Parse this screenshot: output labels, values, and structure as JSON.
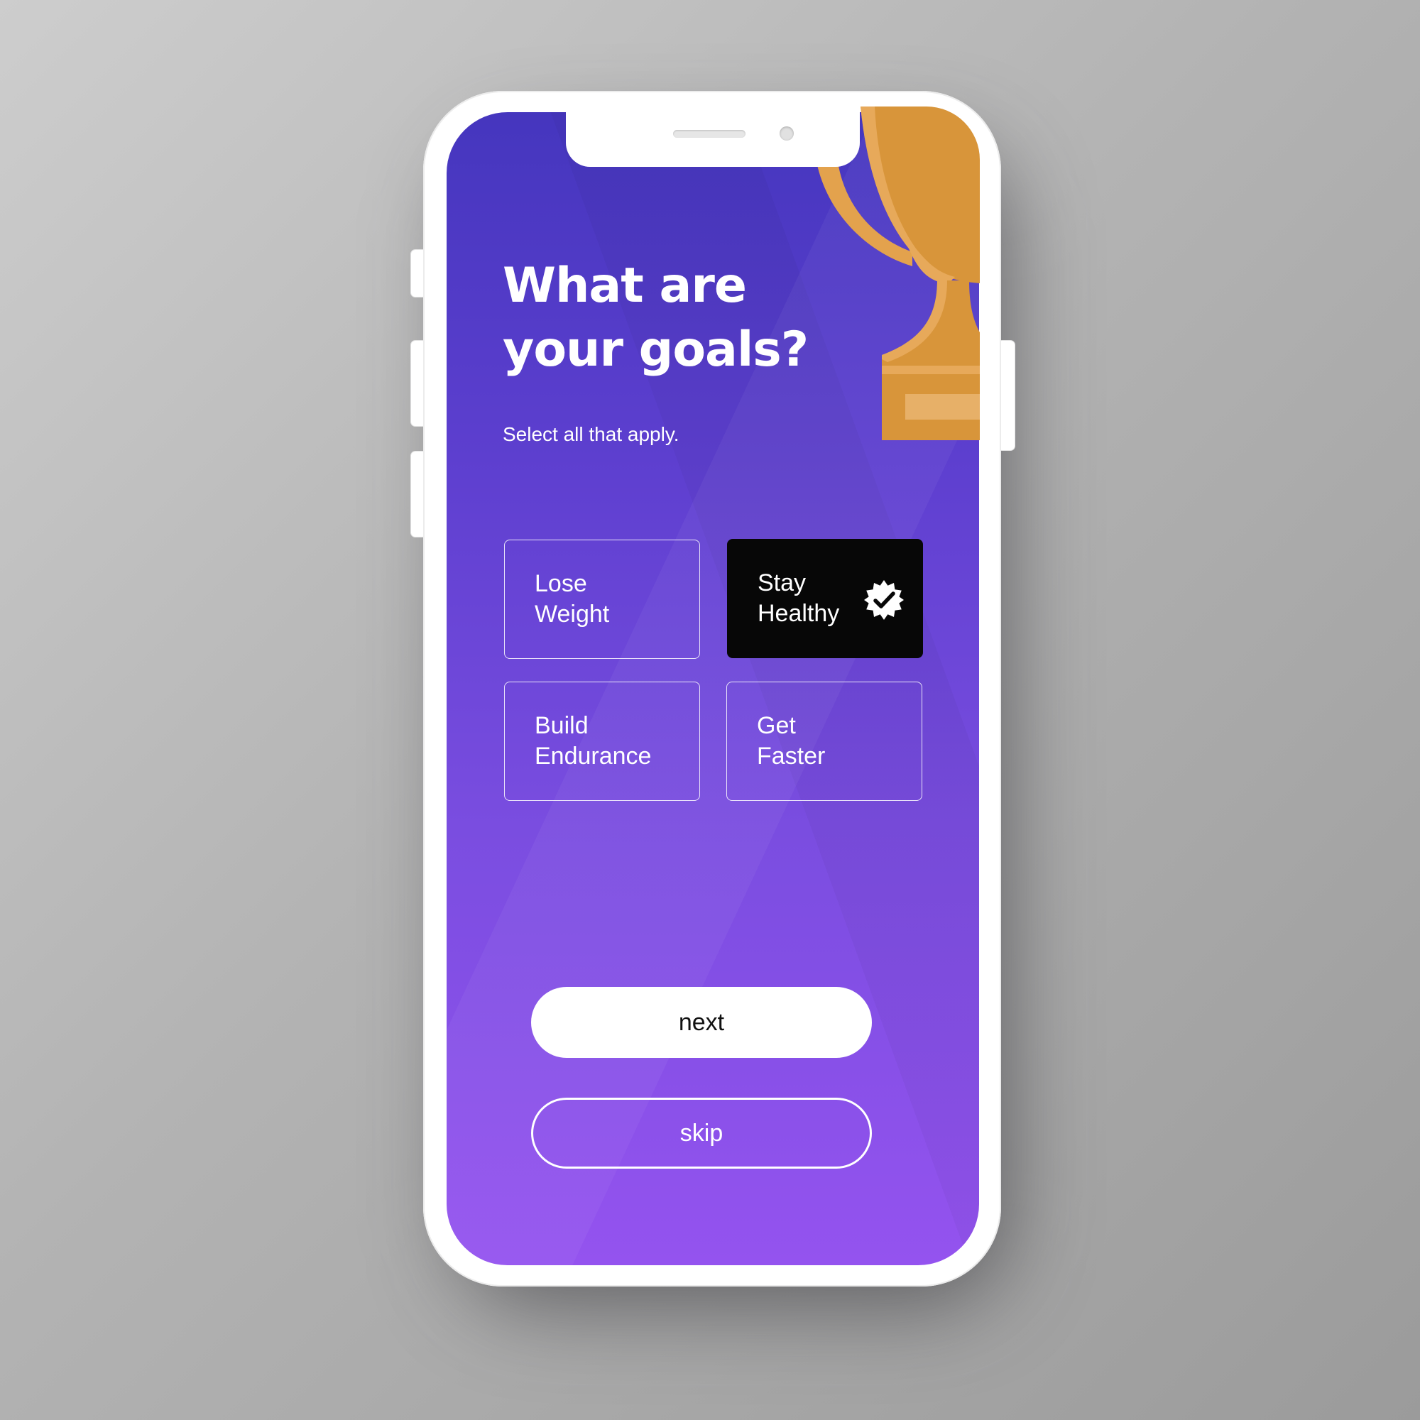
{
  "onboarding": {
    "title_line1": "What are",
    "title_line2": "your goals?",
    "subtitle": "Select all that apply."
  },
  "goals": [
    {
      "line1": "Lose",
      "line2": "Weight",
      "selected": false
    },
    {
      "line1": "Stay",
      "line2": "Healthy",
      "selected": true
    },
    {
      "line1": "Build",
      "line2": "Endurance",
      "selected": false
    },
    {
      "line1": "Get",
      "line2": "Faster",
      "selected": false
    }
  ],
  "actions": {
    "next_label": "next",
    "skip_label": "skip"
  },
  "icons": {
    "selected_badge": "verified-check-badge-icon",
    "illustration": "trophy-icon"
  },
  "colors": {
    "gradient_top": "#4536be",
    "gradient_bottom": "#9453ef",
    "selected_card": "#070707",
    "trophy": "#d8953a"
  }
}
